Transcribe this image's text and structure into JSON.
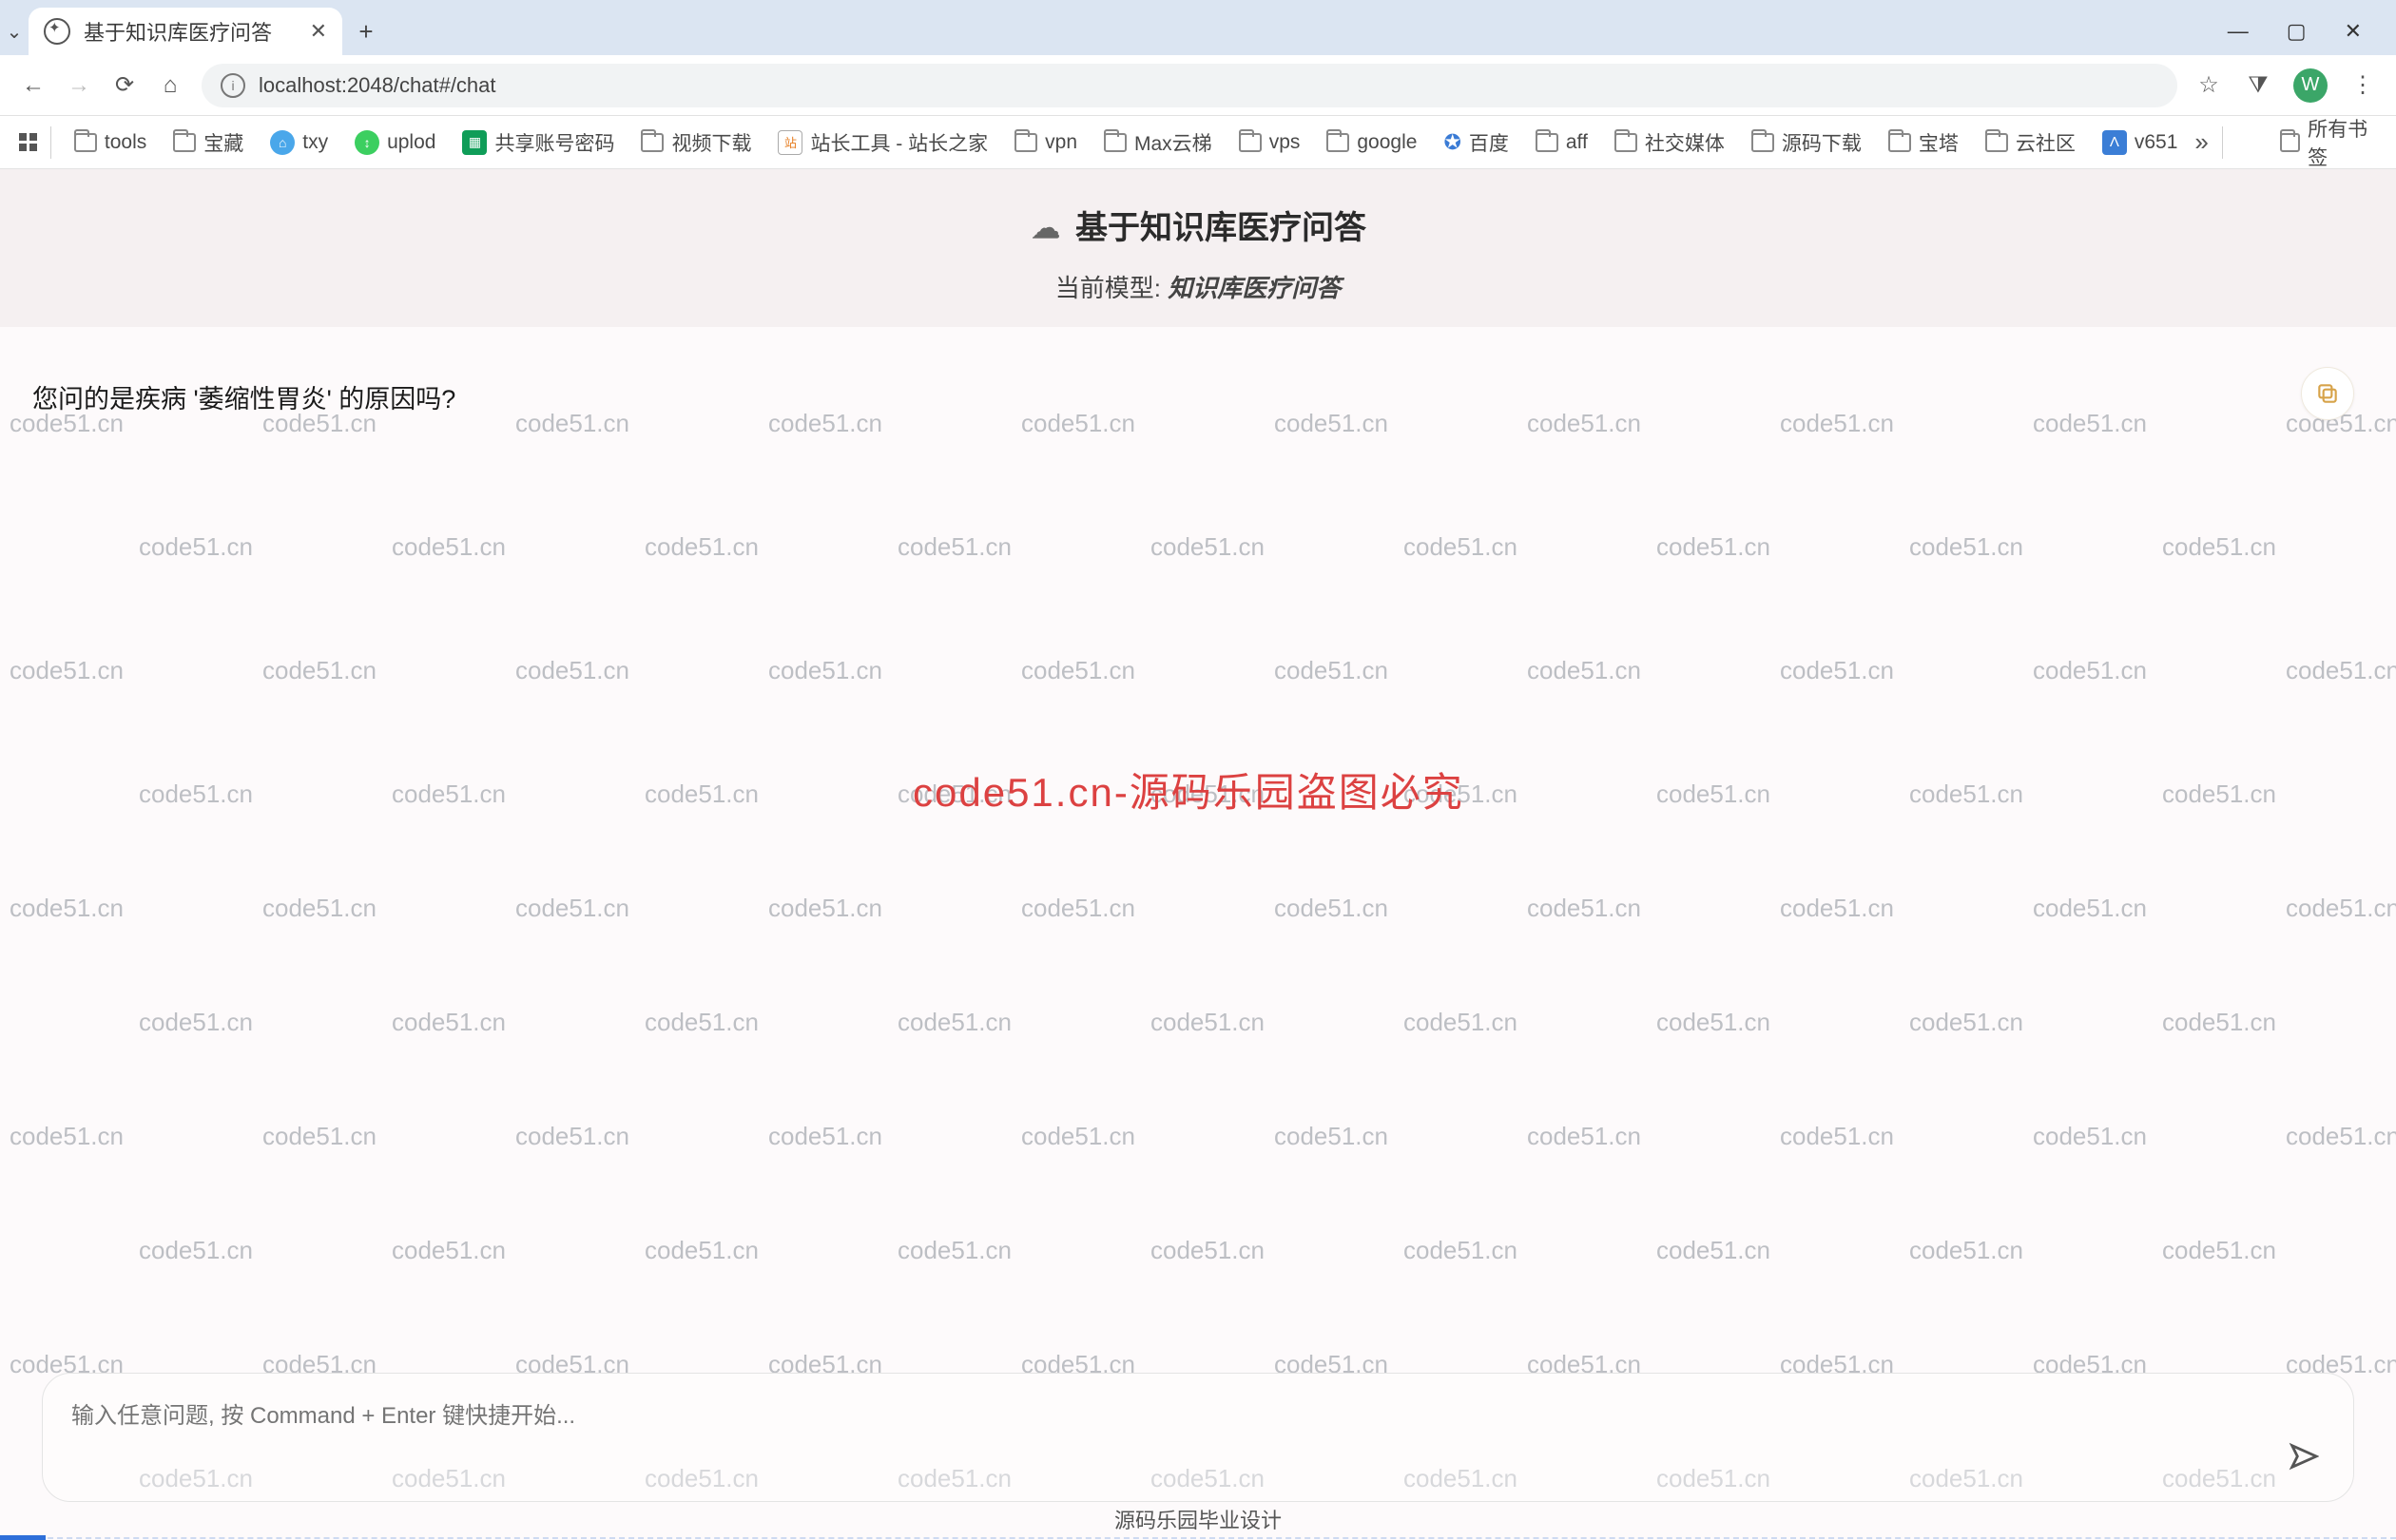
{
  "watermark": {
    "text": "code51.cn",
    "center": "code51.cn-源码乐园盗图必究"
  },
  "browser": {
    "tab_title": "基于知识库医疗问答",
    "url": "localhost:2048/chat#/chat",
    "avatar_letter": "W",
    "bookmarks_bar": {
      "items": [
        {
          "kind": "folder",
          "label": "tools"
        },
        {
          "kind": "folder",
          "label": "宝藏"
        },
        {
          "kind": "txy",
          "label": "txy"
        },
        {
          "kind": "uplod",
          "label": "uplod"
        },
        {
          "kind": "excel",
          "label": "共享账号密码"
        },
        {
          "kind": "folder",
          "label": "视频下载"
        },
        {
          "kind": "zhanzhang",
          "label": "站长工具 - 站长之家"
        },
        {
          "kind": "folder",
          "label": "vpn"
        },
        {
          "kind": "folder",
          "label": "Max云梯"
        },
        {
          "kind": "folder",
          "label": "vps"
        },
        {
          "kind": "folder",
          "label": "google"
        },
        {
          "kind": "baidu",
          "label": "百度"
        },
        {
          "kind": "folder",
          "label": "aff"
        },
        {
          "kind": "folder",
          "label": "社交媒体"
        },
        {
          "kind": "folder",
          "label": "源码下载"
        },
        {
          "kind": "folder",
          "label": "宝塔"
        },
        {
          "kind": "folder",
          "label": "云社区"
        },
        {
          "kind": "v",
          "label": "v651"
        }
      ],
      "all_label": "所有书签"
    }
  },
  "page": {
    "title": "基于知识库医疗问答",
    "model_prefix": "当前模型:",
    "model_name": "知识库医疗问答",
    "chat_message": "您问的是疾病 '萎缩性胃炎' 的原因吗?",
    "composer_placeholder": "输入任意问题, 按 Command + Enter 键快捷开始...",
    "footer": "源码乐园毕业设计"
  }
}
